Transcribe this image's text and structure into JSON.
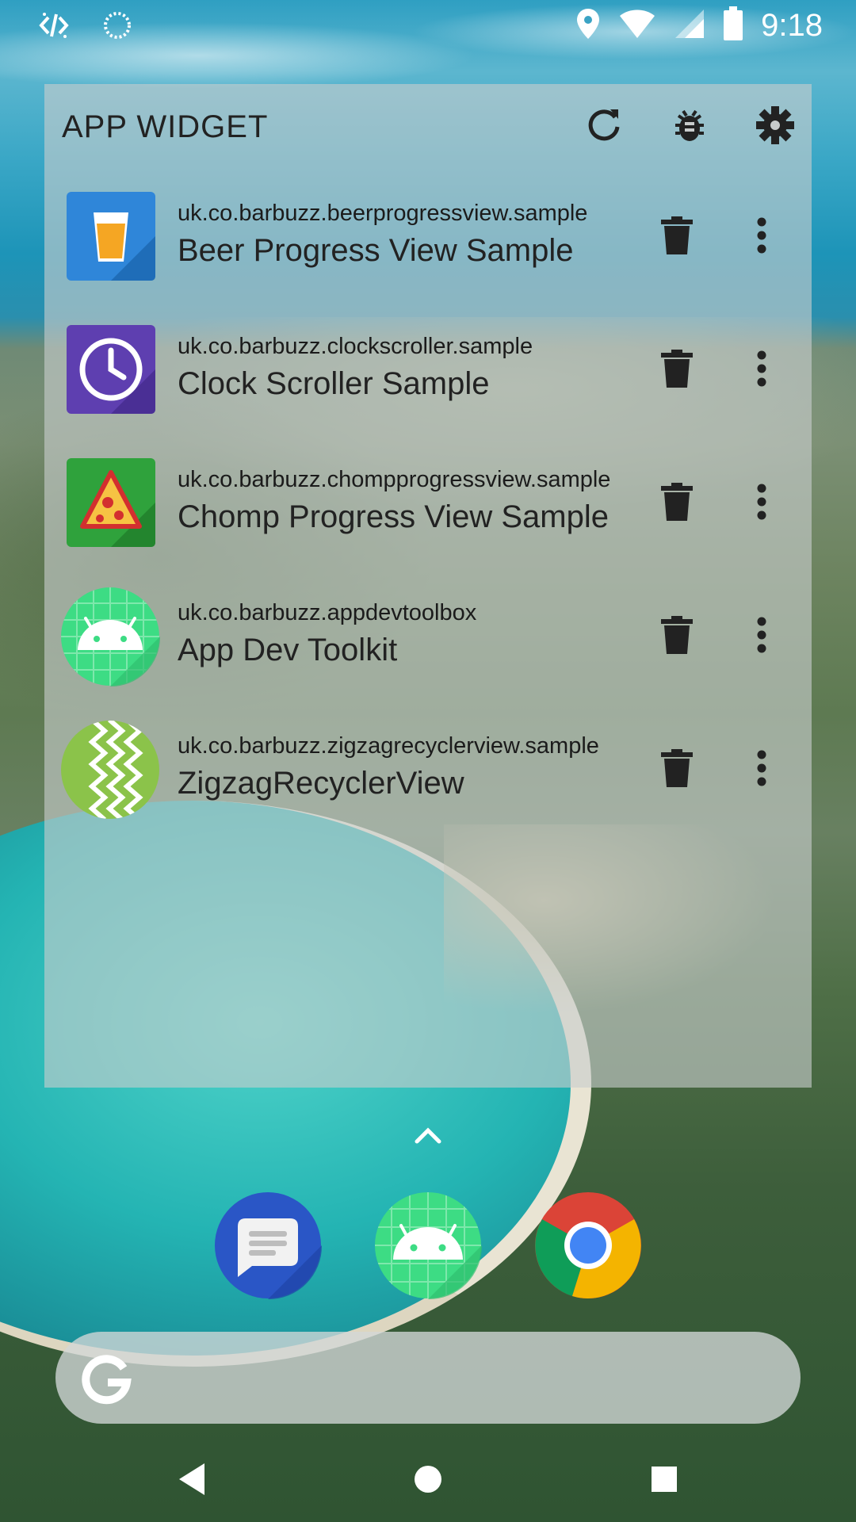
{
  "status_bar": {
    "time": "9:18",
    "icons": [
      "dev-code-icon",
      "sync-icon",
      "location-icon",
      "wifi-icon",
      "signal-icon",
      "battery-icon"
    ]
  },
  "widget": {
    "title": "APP WIDGET",
    "actions": [
      "refresh-icon",
      "bug-icon",
      "gear-icon"
    ],
    "apps": [
      {
        "package": "uk.co.barbuzz.beerprogressview.sample",
        "name": "Beer Progress View Sample",
        "icon": "beer-icon",
        "color": "#2f86d9"
      },
      {
        "package": "uk.co.barbuzz.clockscroller.sample",
        "name": "Clock Scroller Sample",
        "icon": "clock-icon",
        "color": "#5e3fb0"
      },
      {
        "package": "uk.co.barbuzz.chompprogressview.sample",
        "name": "Chomp Progress View Sample",
        "icon": "pizza-icon",
        "color": "#2fa23c"
      },
      {
        "package": "uk.co.barbuzz.appdevtoolbox",
        "name": "App Dev Toolkit",
        "icon": "android-icon",
        "color": "#3ddc84"
      },
      {
        "package": "uk.co.barbuzz.zigzagrecyclerview.sample",
        "name": "ZigzagRecyclerView",
        "icon": "zigzag-icon",
        "color": "#8bc34a"
      }
    ]
  },
  "dock": {
    "apps": [
      "messages-icon",
      "android-toolkit-icon",
      "chrome-icon"
    ]
  },
  "search": {
    "logo": "google-g-icon"
  },
  "nav": [
    "back-icon",
    "home-icon",
    "recents-icon"
  ]
}
